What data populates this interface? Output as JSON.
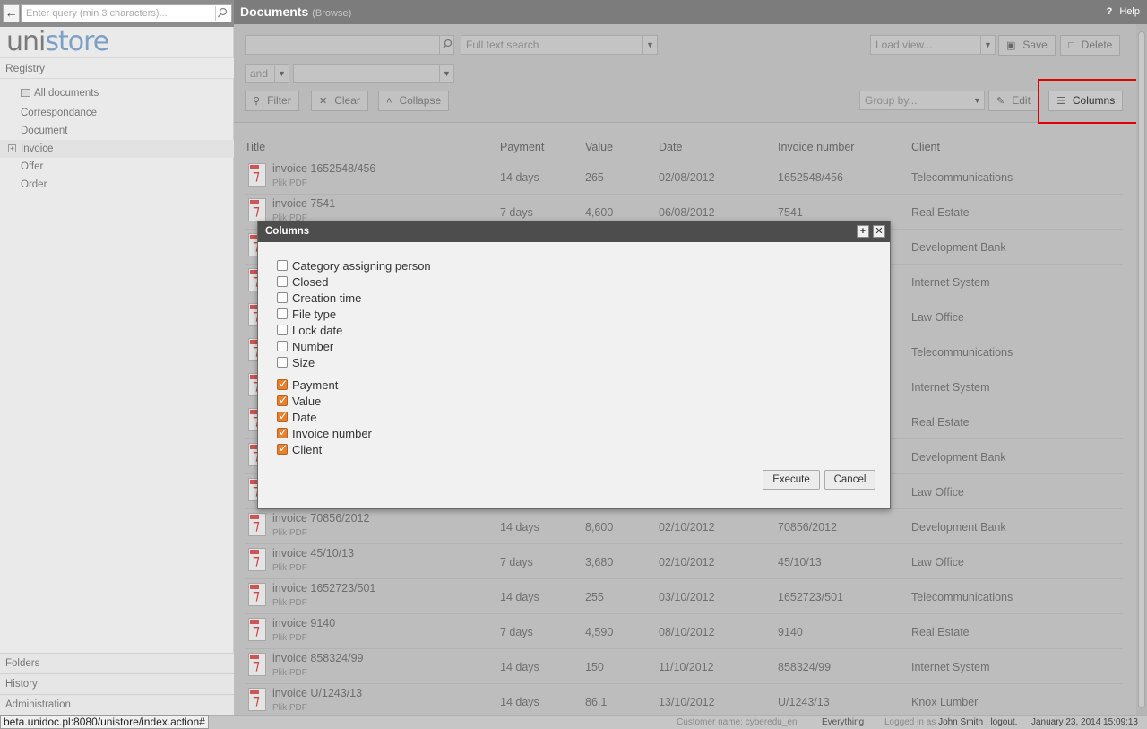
{
  "sidebar": {
    "search_placeholder": "Enter query (min 3 characters)...",
    "logo_part1": "uni",
    "logo_part2": "store",
    "registry_label": "Registry",
    "tree": [
      {
        "label": "All documents"
      },
      {
        "label": "Correspondance"
      },
      {
        "label": "Document"
      },
      {
        "label": "Invoice"
      },
      {
        "label": "Offer"
      },
      {
        "label": "Order"
      }
    ],
    "bottom": [
      "Folders",
      "History",
      "Administration"
    ]
  },
  "header": {
    "title": "Documents",
    "subtitle": "(Browse)",
    "help_label": "Help"
  },
  "filters": {
    "fulltext_label": "Full text search",
    "and_label": "and",
    "load_view_placeholder": "Load view...",
    "save_label": "Save",
    "delete_label": "Delete",
    "filter_label": "Filter",
    "clear_label": "Clear",
    "collapse_label": "Collapse",
    "group_by_placeholder": "Group by...",
    "edit_label": "Edit",
    "columns_label": "Columns"
  },
  "table": {
    "headers": [
      "Title",
      "Payment",
      "Value",
      "Date",
      "Invoice number",
      "Client"
    ],
    "file_type": "Plik PDF",
    "rows": [
      {
        "title": "invoice 1652548/456",
        "payment": "14 days",
        "value": "265",
        "date": "02/08/2012",
        "number": "1652548/456",
        "client": "Telecommunications"
      },
      {
        "title": "invoice 7541",
        "payment": "7 days",
        "value": "4,600",
        "date": "06/08/2012",
        "number": "7541",
        "client": "Real Estate"
      },
      {
        "title": "",
        "payment": "",
        "value": "",
        "date": "",
        "number": "",
        "client": "Development Bank"
      },
      {
        "title": "",
        "payment": "",
        "value": "",
        "date": "",
        "number": "",
        "client": "Internet System"
      },
      {
        "title": "",
        "payment": "",
        "value": "",
        "date": "",
        "number": "",
        "client": "Law Office"
      },
      {
        "title": "",
        "payment": "",
        "value": "",
        "date": "",
        "number": "",
        "client": "Telecommunications"
      },
      {
        "title": "",
        "payment": "",
        "value": "",
        "date": "",
        "number": "",
        "client": "Internet System"
      },
      {
        "title": "",
        "payment": "",
        "value": "",
        "date": "",
        "number": "",
        "client": "Real Estate"
      },
      {
        "title": "",
        "payment": "",
        "value": "",
        "date": "",
        "number": "",
        "client": "Development Bank"
      },
      {
        "title": "",
        "payment": "",
        "value": "",
        "date": "",
        "number": "",
        "client": "Law Office"
      },
      {
        "title": "invoice 70856/2012",
        "payment": "14 days",
        "value": "8,600",
        "date": "02/10/2012",
        "number": "70856/2012",
        "client": "Development Bank"
      },
      {
        "title": "invoice 45/10/13",
        "payment": "7 days",
        "value": "3,680",
        "date": "02/10/2012",
        "number": "45/10/13",
        "client": "Law Office"
      },
      {
        "title": "invoice 1652723/501",
        "payment": "14 days",
        "value": "255",
        "date": "03/10/2012",
        "number": "1652723/501",
        "client": "Telecommunications"
      },
      {
        "title": "invoice 9140",
        "payment": "7 days",
        "value": "4,590",
        "date": "08/10/2012",
        "number": "9140",
        "client": "Real Estate"
      },
      {
        "title": "invoice 858324/99",
        "payment": "14 days",
        "value": "150",
        "date": "11/10/2012",
        "number": "858324/99",
        "client": "Internet System"
      },
      {
        "title": "invoice U/1243/13",
        "payment": "14 days",
        "value": "86.1",
        "date": "13/10/2012",
        "number": "U/1243/13",
        "client": "Knox Lumber"
      }
    ]
  },
  "dialog": {
    "title": "Columns",
    "unchecked": [
      "Category assigning person",
      "Closed",
      "Creation time",
      "File type",
      "Lock date",
      "Number",
      "Size"
    ],
    "checked": [
      "Payment",
      "Value",
      "Date",
      "Invoice number",
      "Client"
    ],
    "execute_label": "Execute",
    "cancel_label": "Cancel"
  },
  "status": {
    "url": "beta.unidoc.pl:8080/unistore/index.action#",
    "customer": "Customer name: cyberedu_en",
    "scope": "Everything",
    "logged_prefix": "Logged in as",
    "user": "John Smith",
    "logout": "logout.",
    "datetime": "January 23, 2014 15:09:13"
  },
  "colors": {
    "accent_checkbox": "#e8812f",
    "highlight_box": "#e00000",
    "logo_blue": "#7da0c6"
  }
}
